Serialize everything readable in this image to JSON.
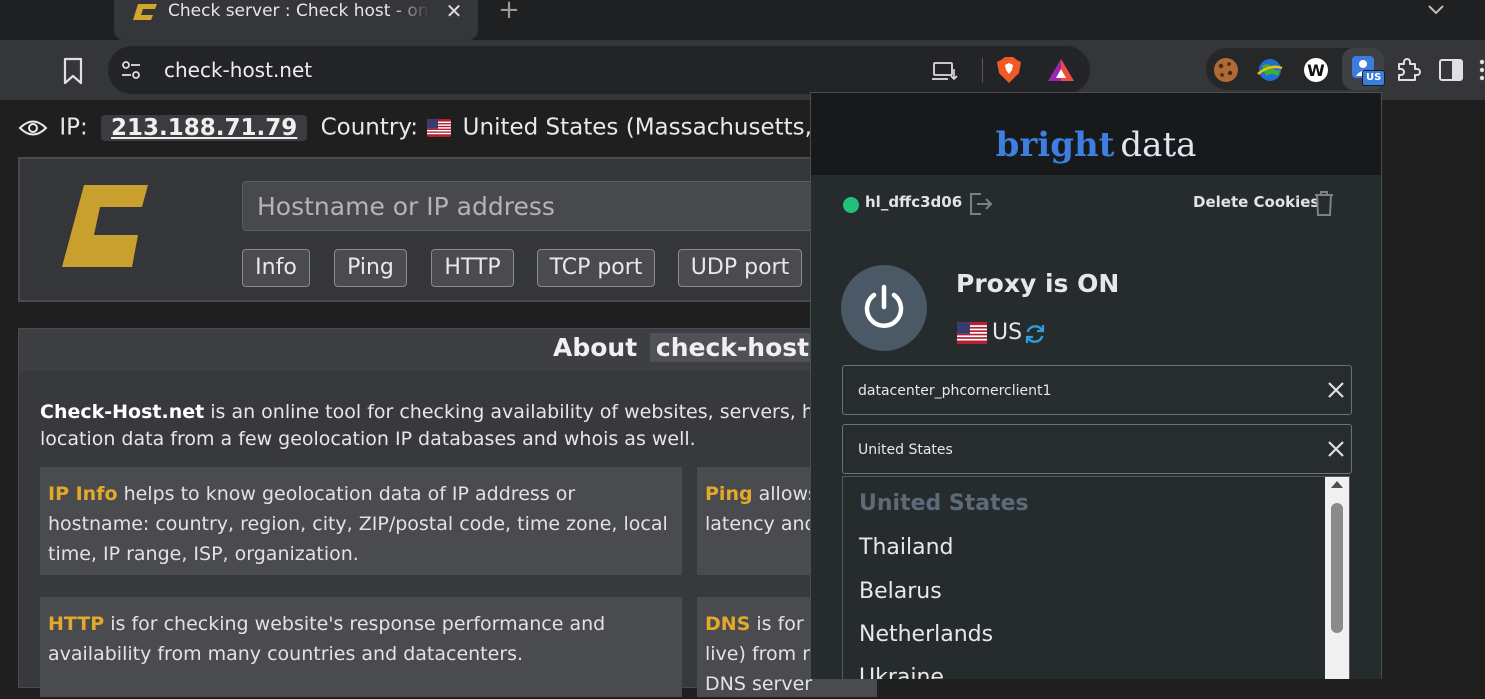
{
  "browser": {
    "tab_title": "Check server : Check host - online website monitoring",
    "url": "check-host.net",
    "ext_badge": "US"
  },
  "page": {
    "ip_label": "IP:",
    "ip_value": "213.188.71.79",
    "country_label": "Country:",
    "country_value": "United States (Massachusetts, Boston)",
    "host_placeholder": "Hostname or IP address",
    "buttons": [
      "Info",
      "Ping",
      "HTTP",
      "TCP port",
      "UDP port"
    ],
    "about_title": "About",
    "about_domain": "check-host.net",
    "about_brand": "Check-Host.net",
    "about_text_1": " is an online tool for checking availability of websites, servers, hosts",
    "about_text_2": "location data from a few geolocation IP databases and whois as well.",
    "cards": {
      "ipinfo": {
        "kw": "IP Info",
        "text": " helps to know geolocation data of IP address or hostname: country, region, city, ZIP/postal code, time zone, local time, IP range, ISP, organization."
      },
      "ping": {
        "kw": "Ping",
        "text": " allows",
        "text2": "latency and"
      },
      "http": {
        "kw": "HTTP",
        "text": " is for checking website's response performance and availability from many countries and datacenters."
      },
      "dns": {
        "kw": "DNS",
        "text": " is for r",
        "text2": "live) from m",
        "text3": "DNS server"
      }
    }
  },
  "popup": {
    "brand_bright": "bright",
    "brand_data": "data",
    "username": "hl_dffc3d06",
    "delete_cookies": "Delete Cookies",
    "proxy_status": "Proxy is ON",
    "proxy_country": "US",
    "zone_value": "datacenter_phcornerclient1",
    "country_value": "United States",
    "dropdown_options": [
      "United States",
      "Thailand",
      "Belarus",
      "Netherlands",
      "Ukraine"
    ]
  },
  "colors": {
    "accent_gold": "#e3a92b",
    "brand_blue": "#3d7ee0",
    "status_green": "#20c27a"
  },
  "icons": [
    "eye-icon",
    "bookmark-icon",
    "site-settings-icon",
    "install-app-icon",
    "brave-shields-icon",
    "brave-rewards-icon",
    "puzzle-icon",
    "side-panel-icon",
    "power-icon",
    "refresh-icon",
    "trash-icon",
    "logout-icon"
  ]
}
